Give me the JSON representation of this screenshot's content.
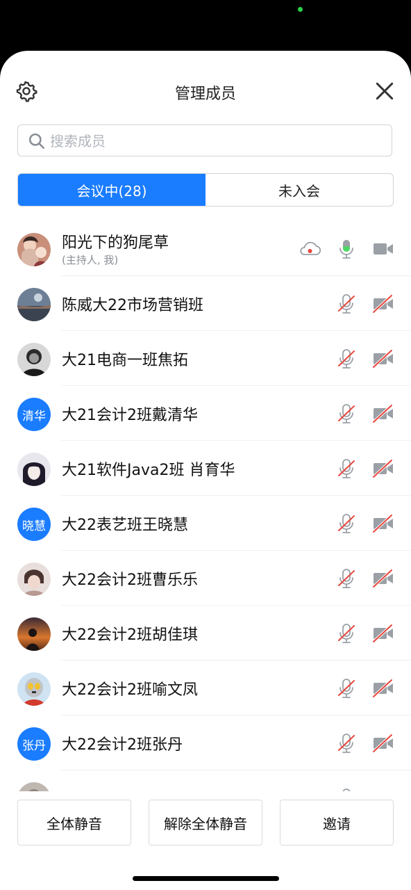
{
  "header": {
    "title": "管理成员",
    "settings_icon": "gear-icon",
    "close_icon": "close-icon"
  },
  "search": {
    "placeholder": "搜索成员",
    "value": ""
  },
  "tabs": [
    {
      "label": "会议中(28)",
      "active": true
    },
    {
      "label": "未入会",
      "active": false
    }
  ],
  "members": [
    {
      "name": "阳光下的狗尾草",
      "role": "(主持人, 我)",
      "avatar": "photo",
      "mic": "on",
      "video": "off",
      "recording": true
    },
    {
      "name": "陈威大22市场营销班",
      "avatar": "photo",
      "mic": "muted",
      "video": "muted"
    },
    {
      "name": "大21电商一班焦拓",
      "avatar": "photo",
      "mic": "muted",
      "video": "muted"
    },
    {
      "name": "大21会计2班戴清华",
      "avatar_text": "清华",
      "mic": "muted",
      "video": "muted"
    },
    {
      "name": "大21软件Java2班 肖育华",
      "avatar": "photo",
      "mic": "muted",
      "video": "muted"
    },
    {
      "name": "大22表艺班王晓慧",
      "avatar_text": "晓慧",
      "mic": "muted",
      "video": "muted"
    },
    {
      "name": "大22会计2班曹乐乐",
      "avatar": "photo",
      "mic": "muted",
      "video": "muted"
    },
    {
      "name": "大22会计2班胡佳琪",
      "avatar": "photo",
      "mic": "muted",
      "video": "muted"
    },
    {
      "name": "大22会计2班喻文凤",
      "avatar": "photo",
      "mic": "muted",
      "video": "muted"
    },
    {
      "name": "大22会计2班张丹",
      "avatar_text": "张丹",
      "mic": "muted",
      "video": "muted"
    }
  ],
  "footer": {
    "mute_all": "全体静音",
    "unmute_all": "解除全体静音",
    "invite": "邀请"
  },
  "colors": {
    "accent": "#1a7cff",
    "mic_active": "#4cd964",
    "muted_red": "#e8453c",
    "icon_gray": "#9aa0a6"
  }
}
